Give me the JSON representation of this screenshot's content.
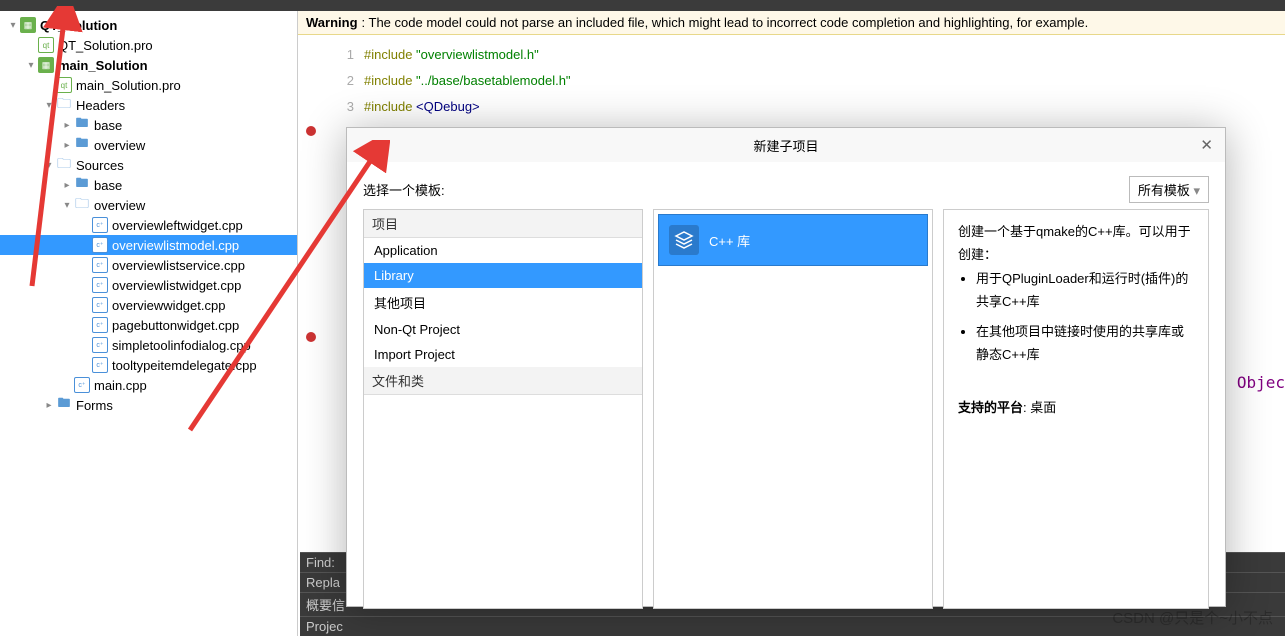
{
  "tree": {
    "root": "QT_Solution",
    "pro1": "QT_Solution.pro",
    "mainsol": "main_Solution",
    "pro2": "main_Solution.pro",
    "headers": "Headers",
    "base": "base",
    "overview": "overview",
    "sources": "Sources",
    "files": {
      "f0": "overviewleftwidget.cpp",
      "f1": "overviewlistmodel.cpp",
      "f2": "overviewlistservice.cpp",
      "f3": "overviewlistwidget.cpp",
      "f4": "overviewwidget.cpp",
      "f5": "pagebuttonwidget.cpp",
      "f6": "simpletoolinfodialog.cpp",
      "f7": "tooltypeitemdelegate.cpp"
    },
    "maincpp": "main.cpp",
    "forms": "Forms"
  },
  "warning": {
    "label": "Warning",
    "text": ": The code model could not parse an included file, which might lead to incorrect code completion and highlighting, for example."
  },
  "code": {
    "l1n": "1",
    "l1a": "#include ",
    "l1b": "\"overviewlistmodel.h\"",
    "l2n": "2",
    "l2a": "#include ",
    "l2b": "\"../base/basetablemodel.h\"",
    "l3n": "3",
    "l3a": "#include ",
    "l3b": "<QDebug>"
  },
  "dialog": {
    "title": "新建子项目",
    "template_label": "选择一个模板:",
    "filter": "所有模板",
    "cat1_hdr": "项目",
    "cat1": {
      "i0": "Application",
      "i1": "Library",
      "i2": "其他项目",
      "i3": "Non-Qt Project",
      "i4": "Import Project"
    },
    "cat2_hdr": "文件和类",
    "tile": "C++ 库",
    "desc_title": "创建一个基于qmake的C++库。可以用于创建：",
    "desc_li1": "用于QPluginLoader和运行时(插件)的共享C++库",
    "desc_li2": "在其他项目中链接时使用的共享库或静态C++库",
    "platform_label": "支持的平台",
    "platform_val": ": 桌面"
  },
  "bottom": {
    "find": "Find:",
    "replace": "Repla",
    "summary": "概要信",
    "project": "Projec"
  },
  "misc": {
    "obj": "Objec"
  },
  "watermark": "CSDN @只是个~小不点"
}
